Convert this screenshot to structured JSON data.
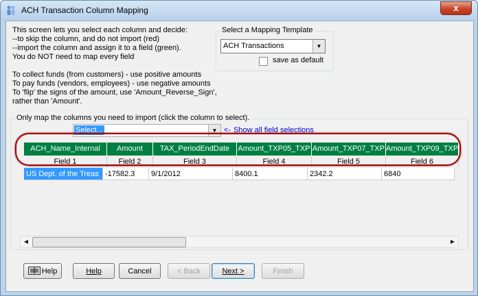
{
  "window": {
    "title": "ACH Transaction Column Mapping",
    "close_label": "x"
  },
  "instructions": "This screen lets you select each column and decide:\n--to skip the column, and do not import (red)\n--import the column and assign it to a field (green).\nYou do NOT need to map every field\n\nTo collect funds (from customers) - use positive amounts\nTo pay funds (vendors, employees) - use negative amounts\nTo 'flip' the signs of the amount, use 'Amount_Reverse_Sign',\nrather than 'Amount'.",
  "template": {
    "group_label": "Select a Mapping Template",
    "selected": "ACH Transactions",
    "save_default_label": "save as default",
    "save_default_checked": false
  },
  "mapping": {
    "group_label": "Only map the columns you need to import (click the column to select).",
    "field_select_value": "Select...",
    "show_all_link": "Show all field selections",
    "show_all_prefix": "<-",
    "columns": [
      {
        "header": "ACH_Name_Internal",
        "field": "Field 1",
        "value": "US Dept. of the Treas"
      },
      {
        "header": "Amount",
        "field": "Field 2",
        "value": "-17582.3"
      },
      {
        "header": "TAX_PeriodEndDate",
        "field": "Field 3",
        "value": "9/1/2012"
      },
      {
        "header": "Amount_TXP05_TXP",
        "field": "Field 4",
        "value": "8400.1"
      },
      {
        "header": "Amount_TXP07_TXP",
        "field": "Field 5",
        "value": "2342.2"
      },
      {
        "header": "Amount_TXP09_TXP",
        "field": "Field 6",
        "value": "6840"
      }
    ]
  },
  "buttons": {
    "help_icon_label": "Help",
    "help": "Help",
    "cancel": "Cancel",
    "back": "< Back",
    "next": "Next >",
    "finish": "Finish"
  },
  "colors": {
    "mapped_header": "#008040",
    "selected_cell": "#3399ff",
    "highlight_ring": "#a80000"
  }
}
